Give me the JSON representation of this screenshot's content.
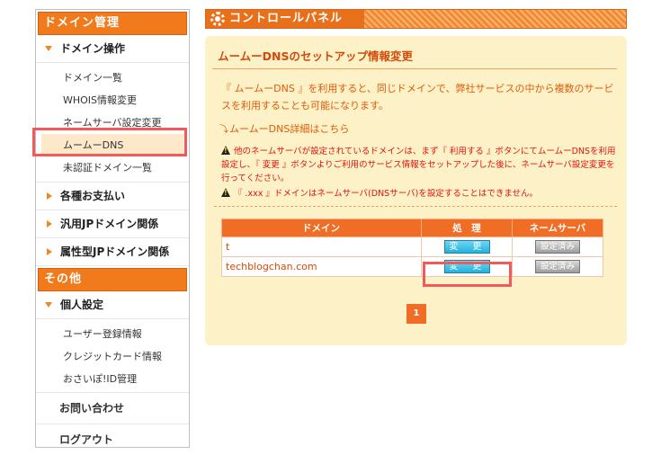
{
  "sidebar": {
    "section1": "ドメイン管理",
    "domain_ops": {
      "label": "ドメイン操作",
      "items": [
        "ドメイン一覧",
        "WHOIS情報変更",
        "ネームサーバ設定変更",
        "ムームーDNS",
        "未認証ドメイン一覧"
      ]
    },
    "payments": "各種お支払い",
    "gtld": "汎用JPドメイン関係",
    "attr_jp": "属性型JPドメイン関係",
    "section2": "その他",
    "personal": {
      "label": "個人設定",
      "items": [
        "ユーザー登録情報",
        "クレジットカード情報",
        "おさいぽ!ID管理"
      ]
    },
    "contact": "お問い合わせ",
    "logout": "ログアウト"
  },
  "control_panel": {
    "title": "コントロールパネル"
  },
  "panel": {
    "title": "ムームーDNSのセットアップ情報変更",
    "intro": "『 ムームーDNS 』を利用すると、同じドメインで、弊社サービスの中から複数のサービスを利用することも可能になります。",
    "link_arrow": "⤵",
    "link": "ムームーDNS詳細はこちら",
    "warning1": "他のネームサーバが設定されているドメインは、まず『 利用する 』ボタンにてムームーDNSを利用設定し、『 変更 』ボタンよりご利用のサービス情報をセットアップした後に、ネームサーバ設定変更を行ってください。",
    "warning2": "『 .xxx 』ドメインはネームサーバ(DNSサーバ)を設定することはできません。"
  },
  "table": {
    "headers": {
      "domain": "ドメイン",
      "process": "処　理",
      "nameserver": "ネームサーバ"
    },
    "rows": [
      {
        "domain": "t",
        "process": "変　更",
        "nameserver": "設定済み"
      },
      {
        "domain": "techblogchan.com",
        "process": "変　更",
        "nameserver": "設定済み"
      }
    ]
  },
  "pagination": {
    "current": "1"
  }
}
